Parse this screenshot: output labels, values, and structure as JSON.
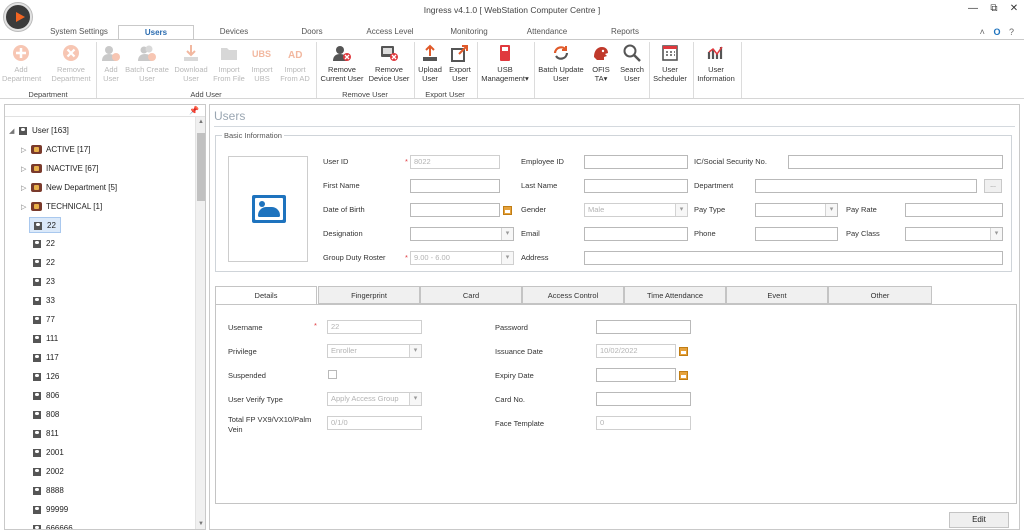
{
  "window": {
    "title": "Ingress v4.1.0 [ WebStation Computer Centre ]",
    "minimize": "—",
    "restore": "⧉",
    "close": "✕"
  },
  "tabs": [
    "System Settings",
    "Users",
    "Devices",
    "Doors",
    "Access Level",
    "Monitoring",
    "Attendance",
    "Reports"
  ],
  "active_tab": "Users",
  "help_icons": {
    "chevron": "˄",
    "office": "O",
    "help": "?"
  },
  "ribbon": {
    "buttons": [
      {
        "label": "Add Department",
        "icon": "add-department-icon",
        "disabled": true
      },
      {
        "label": "Remove Department",
        "icon": "remove-department-icon",
        "disabled": true
      },
      {
        "label": "Add User",
        "icon": "add-user-icon",
        "disabled": true
      },
      {
        "label": "Batch Create User",
        "icon": "batch-create-user-icon",
        "disabled": true
      },
      {
        "label": "Download User",
        "icon": "download-user-icon",
        "disabled": true
      },
      {
        "label": "Import From File",
        "icon": "import-file-icon",
        "disabled": true
      },
      {
        "label": "Import UBS",
        "icon": "import-ubs-icon",
        "disabled": true
      },
      {
        "label": "Import From AD",
        "icon": "import-ad-icon",
        "disabled": true
      },
      {
        "label": "Remove Current User",
        "icon": "remove-current-user-icon",
        "disabled": false
      },
      {
        "label": "Remove Device User",
        "icon": "remove-device-user-icon",
        "disabled": false
      },
      {
        "label": "Upload User",
        "icon": "upload-user-icon",
        "disabled": false
      },
      {
        "label": "Export User",
        "icon": "export-user-icon",
        "disabled": false
      },
      {
        "label": "USB Management",
        "icon": "usb-management-icon",
        "disabled": false
      },
      {
        "label": "Batch Update User",
        "icon": "batch-update-user-icon",
        "disabled": false
      },
      {
        "label": "OFIS TA",
        "icon": "ofis-ta-icon",
        "disabled": false
      },
      {
        "label": "Search User",
        "icon": "search-user-icon",
        "disabled": false
      },
      {
        "label": "User Scheduler",
        "icon": "user-scheduler-icon",
        "disabled": false
      },
      {
        "label": "User Information",
        "icon": "user-information-icon",
        "disabled": false
      }
    ],
    "groups": [
      "Department",
      "Add User",
      "Remove User",
      "Export User"
    ]
  },
  "tree": {
    "pin": "📌",
    "root": "User [163]",
    "groups": [
      "ACTIVE [17]",
      "INACTIVE [67]",
      "New Department [5]",
      "TECHNICAL [1]"
    ],
    "users": [
      "22",
      "22",
      "22",
      "23",
      "33",
      "77",
      "111",
      "117",
      "126",
      "806",
      "808",
      "811",
      "2001",
      "2002",
      "8888",
      "99999",
      "666666"
    ]
  },
  "main": {
    "title": "Users",
    "basic_info_legend": "Basic Information",
    "fields": {
      "user_id": {
        "label": "User ID",
        "value": "8022"
      },
      "employee_id": {
        "label": "Employee ID",
        "value": ""
      },
      "ic": {
        "label": "IC/Social Security No.",
        "value": ""
      },
      "first_name": {
        "label": "First Name",
        "value": ""
      },
      "last_name": {
        "label": "Last Name",
        "value": ""
      },
      "department": {
        "label": "Department",
        "value": "",
        "button": "..."
      },
      "dob": {
        "label": "Date of Birth",
        "value": ""
      },
      "gender": {
        "label": "Gender",
        "value": "Male"
      },
      "pay_type": {
        "label": "Pay Type",
        "value": ""
      },
      "pay_rate": {
        "label": "Pay Rate",
        "value": ""
      },
      "designation": {
        "label": "Designation",
        "value": ""
      },
      "email": {
        "label": "Email",
        "value": ""
      },
      "phone": {
        "label": "Phone",
        "value": ""
      },
      "pay_class": {
        "label": "Pay Class",
        "value": ""
      },
      "group_duty_roster": {
        "label": "Group Duty Roster",
        "value": "9.00 - 6.00"
      },
      "address": {
        "label": "Address",
        "value": ""
      }
    },
    "detail_tabs": [
      "Details",
      "Fingerprint",
      "Card",
      "Access Control",
      "Time Attendance",
      "Event",
      "Other"
    ],
    "details": {
      "username": {
        "label": "Username",
        "value": "22"
      },
      "privilege": {
        "label": "Privilege",
        "value": "Enroller"
      },
      "suspended": {
        "label": "Suspended"
      },
      "verify_type": {
        "label": "User Verify Type",
        "value": "Apply Access Group"
      },
      "total_fp": {
        "label": "Total FP VX9/VX10/Palm Vein",
        "value": "0/1/0"
      },
      "password": {
        "label": "Password",
        "value": ""
      },
      "issuance_date": {
        "label": "Issuance Date",
        "value": "10/02/2022"
      },
      "expiry_date": {
        "label": "Expiry Date",
        "value": ""
      },
      "card_no": {
        "label": "Card No.",
        "value": ""
      },
      "face_template": {
        "label": "Face Template",
        "value": "0"
      }
    },
    "edit_button": "Edit",
    "required_mark": "*"
  }
}
